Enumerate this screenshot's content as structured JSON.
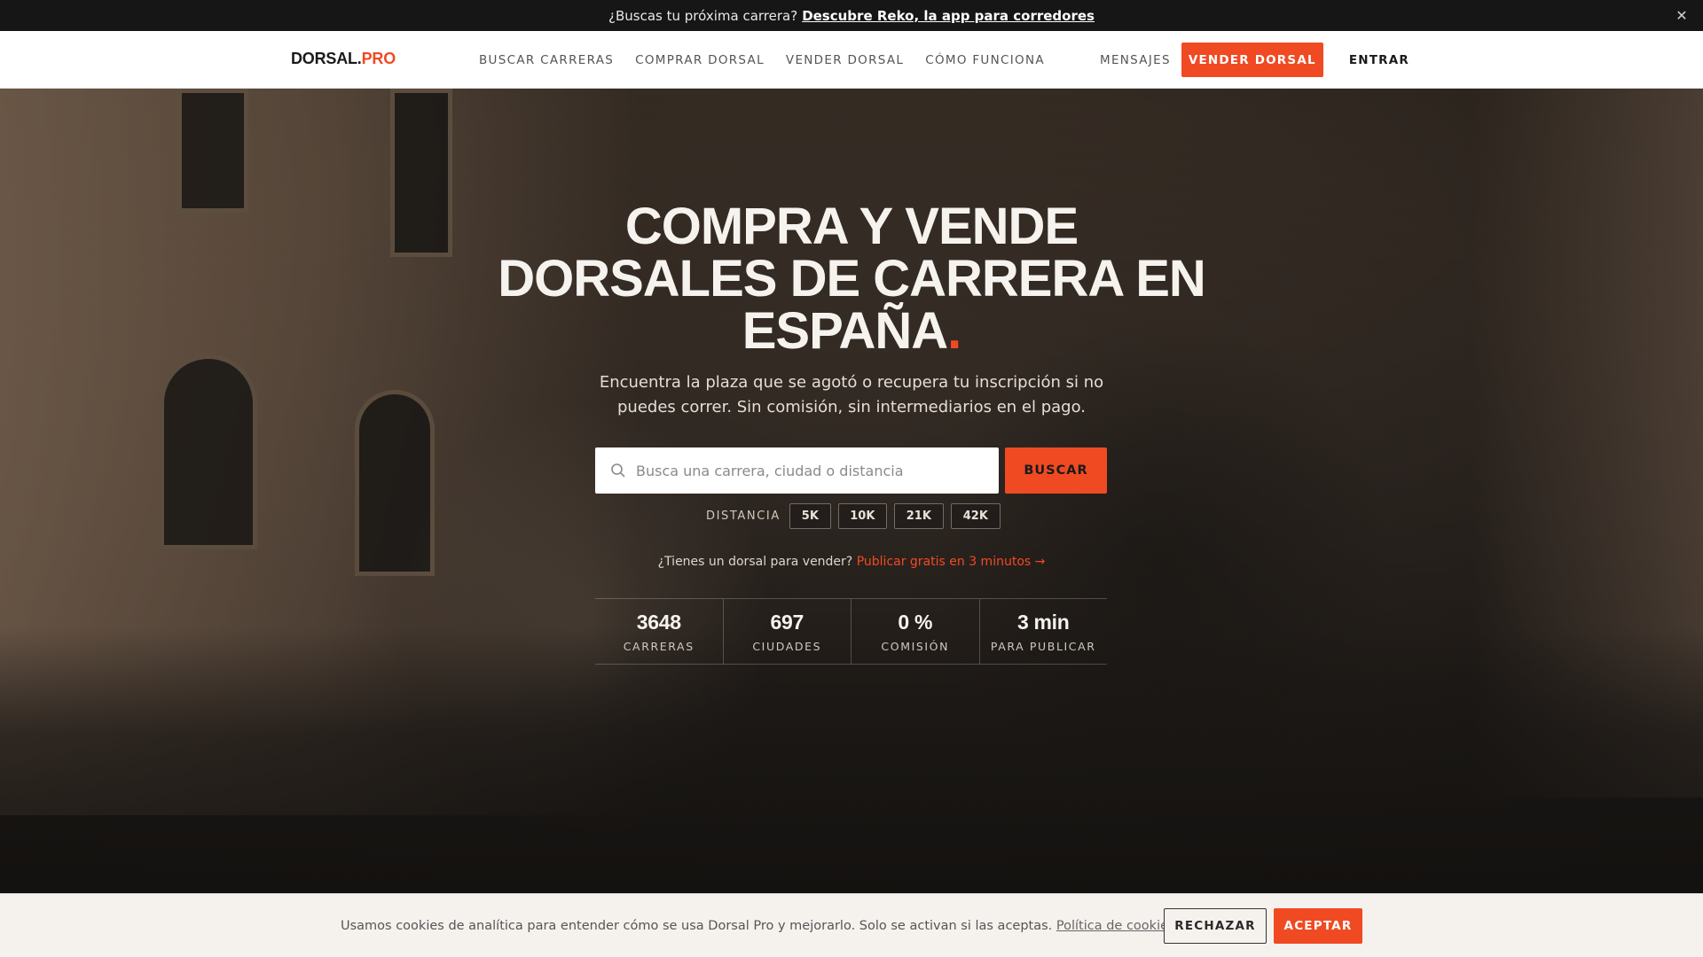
{
  "announcement": {
    "text": "¿Buscas tu próxima carrera?",
    "link": "Descubre Reko, la app para corredores",
    "close_icon": "close-icon"
  },
  "header": {
    "logo_main": "DORSAL.",
    "logo_accent": "PRO",
    "nav": [
      {
        "label": "BUSCAR CARRERAS"
      },
      {
        "label": "COMPRAR DORSAL"
      },
      {
        "label": "VENDER DORSAL"
      },
      {
        "label": "CÓMO FUNCIONA"
      }
    ],
    "messages": "MENSAJES",
    "sell_button": "VENDER DORSAL",
    "login": "ENTRAR"
  },
  "hero": {
    "title": "COMPRA Y VENDE DORSALES DE CARRERA EN ESPAÑA",
    "title_dot": ".",
    "subtitle": "Encuentra la plaza que se agotó o recupera tu inscripción si no puedes correr. Sin comisión, sin intermediarios en el pago.",
    "search": {
      "placeholder": "Busca una carrera, ciudad o distancia",
      "value": "",
      "icon": "search-icon",
      "button": "BUSCAR"
    },
    "distance": {
      "label": "DISTANCIA",
      "options": [
        "5K",
        "10K",
        "21K",
        "42K"
      ]
    },
    "sell_prompt": "¿Tienes un dorsal para vender?",
    "sell_link": "Publicar gratis en 3 minutos →",
    "stats": [
      {
        "value": "3648",
        "label": "CARRERAS"
      },
      {
        "value": "697",
        "label": "CIUDADES"
      },
      {
        "value": "0 %",
        "label": "COMISIÓN"
      },
      {
        "value": "3 min",
        "label": "PARA PUBLICAR"
      }
    ]
  },
  "cookies": {
    "text": "Usamos cookies de analítica para entender cómo se usa Dorsal Pro y mejorarlo. Solo se activan si las aceptas.",
    "policy_link": "Política de cookies",
    "reject": "RECHAZAR",
    "accept": "ACEPTAR"
  },
  "colors": {
    "accent": "#f04a23",
    "announce_bg": "#161616",
    "header_bg": "#ffffff",
    "cookie_bg": "#f5f2ee"
  }
}
